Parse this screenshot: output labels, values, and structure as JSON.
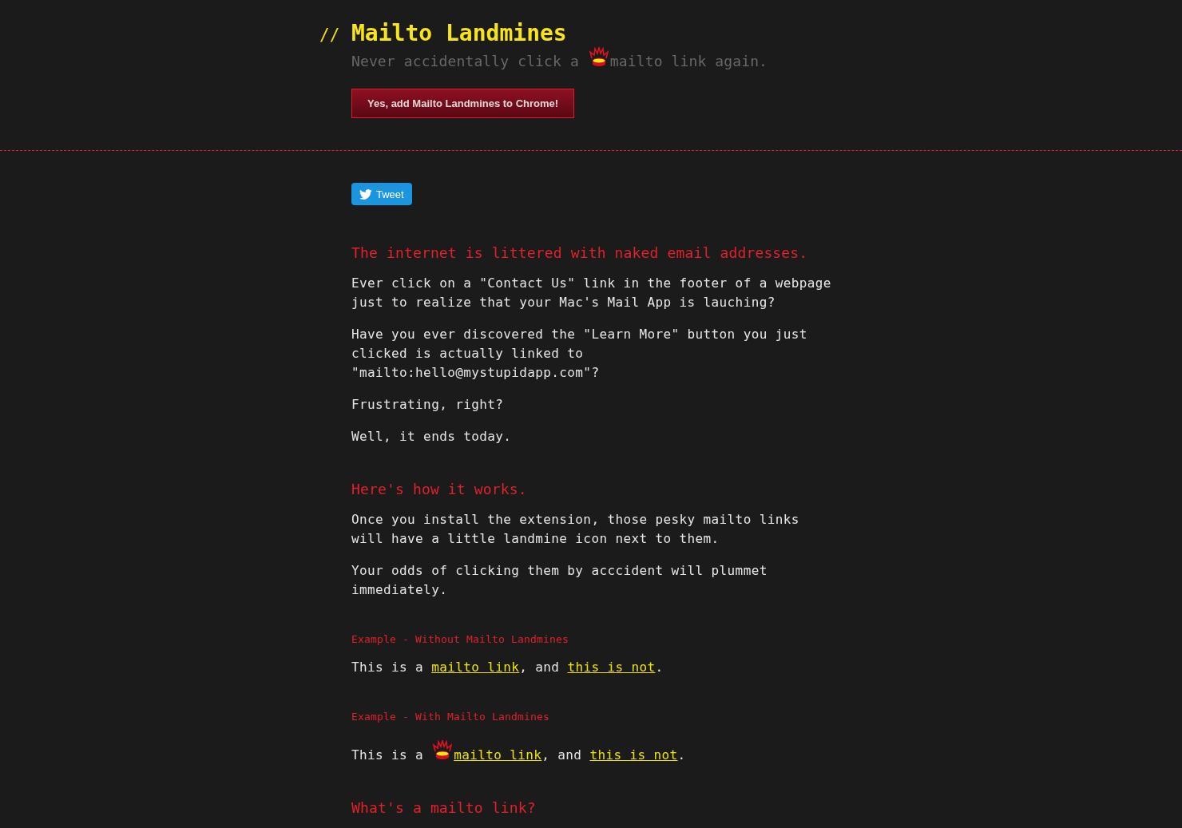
{
  "header": {
    "title_prefix": "//",
    "title": "Mailto Landmines",
    "tagline": {
      "before_icon": "Never accidentally click a ",
      "after_icon": "mailto link again."
    },
    "install_button": "Yes, add Mailto Landmines to Chrome!"
  },
  "tweet_button": "Tweet",
  "content": [
    {
      "kind": "heading",
      "text": "The internet is littered with naked email addresses."
    },
    {
      "kind": "paragraph",
      "text": "Ever click on a \"Contact Us\" link in the footer of a webpage just to realize that your Mac's Mail App is lauching?"
    },
    {
      "kind": "paragraph",
      "text": "Have you ever discovered the \"Learn More\" button you just clicked is actually linked to \"mailto:hello@mystupidapp.com\"?"
    },
    {
      "kind": "paragraph",
      "text": "Frustrating, right?"
    },
    {
      "kind": "paragraph",
      "text": "Well, it ends today."
    },
    {
      "kind": "heading",
      "text": "Here's how it works."
    },
    {
      "kind": "paragraph",
      "text": "Once you install the extension, those pesky mailto links will have a little landmine icon next to them."
    },
    {
      "kind": "paragraph",
      "text": "Your odds of clicking them by acccident will plummet immediately."
    },
    {
      "kind": "example_label",
      "text": "Example - Without Mailto Landmines"
    },
    {
      "kind": "example",
      "landmine": false,
      "before": "This is a ",
      "link": "mailto link",
      "middle": ", and ",
      "second_link": "this is not",
      "after": "."
    },
    {
      "kind": "example_label",
      "text": "Example - With Mailto Landmines"
    },
    {
      "kind": "example",
      "landmine": true,
      "before": "This is a ",
      "link": "mailto link",
      "middle": ", and ",
      "second_link": "this is not",
      "after": "."
    },
    {
      "kind": "heading",
      "text": "What's a mailto link?"
    }
  ]
}
